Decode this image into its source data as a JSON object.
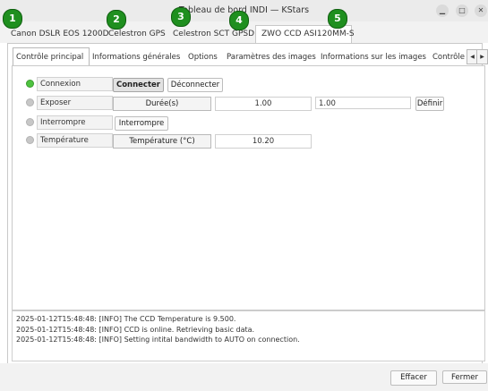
{
  "window": {
    "title": "Tableau de bord INDI — KStars",
    "controls": [
      "minimize-icon",
      "maximize-icon",
      "close-icon"
    ]
  },
  "device_tabs": [
    {
      "label": "Canon DSLR EOS 1200D"
    },
    {
      "label": "Celestron GPS"
    },
    {
      "label": "Celestron SCT"
    },
    {
      "label": "GPSD"
    },
    {
      "label": "ZWO CCD ASI120MM-S"
    }
  ],
  "badges": [
    "1",
    "2",
    "3",
    "4",
    "5"
  ],
  "property_tabs": [
    {
      "label": "Contrôle principal"
    },
    {
      "label": "Informations générales"
    },
    {
      "label": "Options"
    },
    {
      "label": "Paramètres des images"
    },
    {
      "label": "Informations sur les images"
    },
    {
      "label": "Contrôle"
    }
  ],
  "tab_scroll": {
    "left": "◀",
    "right": "▶"
  },
  "properties": {
    "connexion": {
      "label": "Connexion",
      "connect": "Connecter",
      "disconnect": "Déconnecter"
    },
    "exposer": {
      "label": "Exposer",
      "element": "Durée(s)",
      "value": "1.00",
      "new_value": "1.00",
      "set": "Définir"
    },
    "interrompre": {
      "label": "Interrompre",
      "button": "Interrompre"
    },
    "temperature": {
      "label": "Température",
      "element": "Température (°C)",
      "value": "10.20"
    }
  },
  "log": [
    "2025-01-12T15:48:48: [INFO] The CCD Temperature is 9.500.",
    "2025-01-12T15:48:48: [INFO] CCD is online. Retrieving basic data.",
    "2025-01-12T15:48:48: [INFO] Setting intital bandwidth to AUTO on connection."
  ],
  "footer": {
    "clear": "Effacer",
    "close": "Fermer"
  }
}
